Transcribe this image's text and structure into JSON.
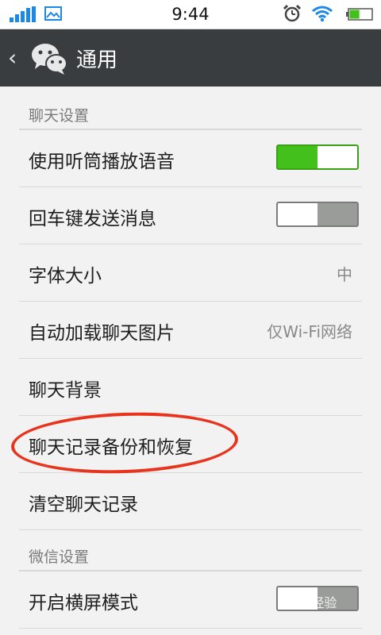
{
  "status_bar": {
    "time": "9:44",
    "signal_icon": "signal-bars-icon",
    "photo_icon": "photo-notification-icon",
    "alarm_icon": "alarm-clock-icon",
    "wifi_icon": "wifi-icon",
    "battery_icon": "battery-icon",
    "battery_level": 0.45,
    "accent": "#1e88e5",
    "battery_color": "#44c01c"
  },
  "header": {
    "title": "通用",
    "back_icon": "back-chevron-icon",
    "app_icon": "wechat-icon",
    "background": "#3a3d3f"
  },
  "sections": [
    {
      "title": "聊天设置",
      "rows": [
        {
          "label": "使用听筒播放语音",
          "type": "toggle",
          "on": true
        },
        {
          "label": "回车键发送消息",
          "type": "toggle",
          "on": false
        },
        {
          "label": "字体大小",
          "type": "value",
          "value": "中"
        },
        {
          "label": "自动加载聊天图片",
          "type": "value",
          "value": "仅Wi-Fi网络"
        },
        {
          "label": "聊天背景",
          "type": "plain"
        },
        {
          "label": "聊天记录备份和恢复",
          "type": "plain",
          "highlighted": true
        },
        {
          "label": "清空聊天记录",
          "type": "plain"
        }
      ]
    },
    {
      "title": "微信设置",
      "rows": [
        {
          "label": "开启横屏模式",
          "type": "toggle",
          "on": false
        }
      ]
    }
  ],
  "colors": {
    "toggle_on": "#44c01c",
    "toggle_off": "#9a9c9a",
    "highlight": "#e8341c"
  },
  "watermark": "Bai 经验"
}
